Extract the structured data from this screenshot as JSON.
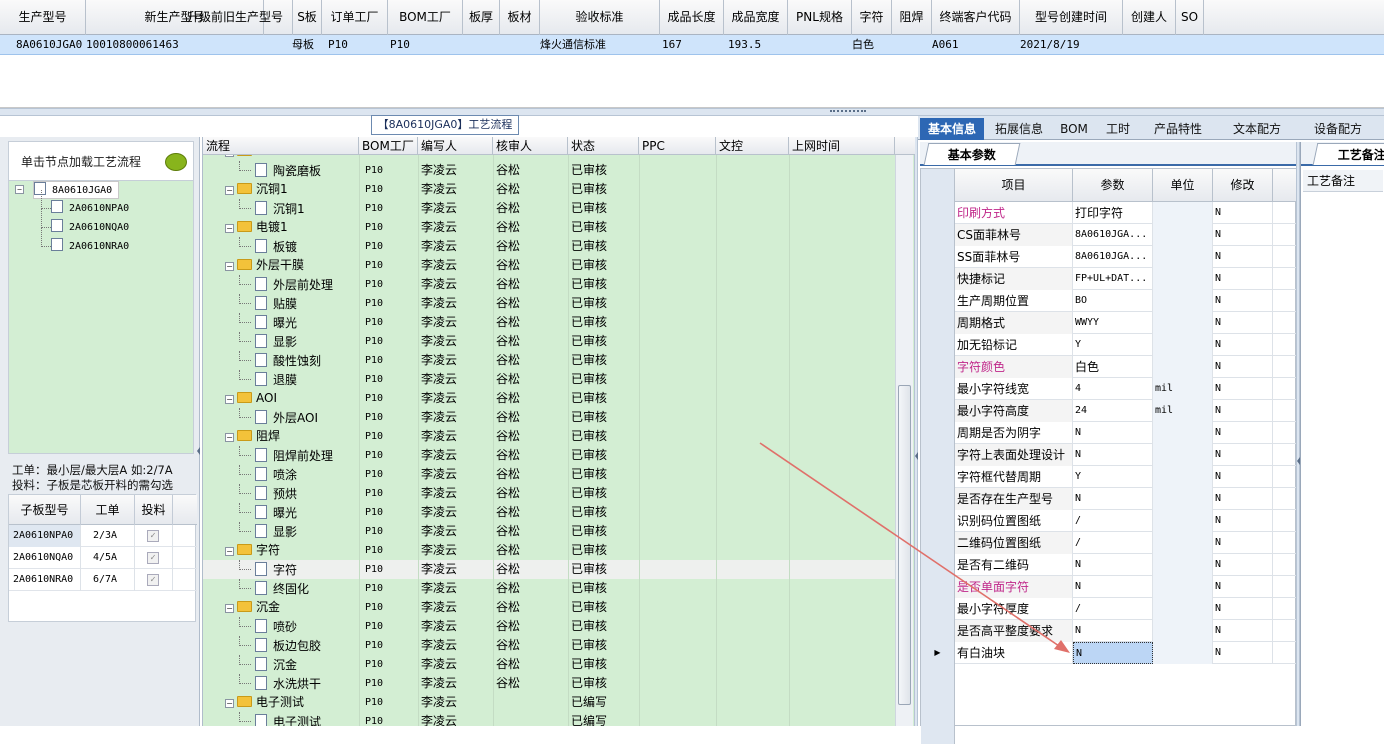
{
  "top_grid": {
    "headers": [
      "生产型号",
      "新生产型号",
      "升级前旧生产型号",
      "S板",
      "订单工厂",
      "BOM工厂",
      "板厚",
      "板材",
      "验收标准",
      "成品长度",
      "成品宽度",
      "PNL规格",
      "字符",
      "阻焊",
      "终端客户代码",
      "型号创建时间",
      "创建人",
      "SO"
    ],
    "row": [
      "8A0610JGA0",
      "10010800061463",
      "",
      "母板",
      "P10",
      "P10",
      "",
      "",
      "烽火通信标准",
      "167",
      "193.5",
      "",
      "白色",
      "",
      "A061",
      "2021/8/19",
      "",
      ""
    ]
  },
  "flow_title": "【8A0610JGA0】工艺流程",
  "left": {
    "tree_header": "单击节点加载工艺流程",
    "tree": {
      "root": "8A0610JGA0",
      "children": [
        "2A0610NPA0",
        "2A0610NQA0",
        "2A0610NRA0"
      ]
    },
    "note_line1": "工单：最小层/最大层A 如:2/7A",
    "note_line2": "投料：子板是芯板开料的需勾选",
    "sub_grid": {
      "headers": [
        "子板型号",
        "工单",
        "投料"
      ],
      "rows": [
        {
          "model": "2A0610NPA0",
          "order": "2/3A",
          "check": "✓"
        },
        {
          "model": "2A0610NQA0",
          "order": "4/5A",
          "check": "✓"
        },
        {
          "model": "2A0610NRA0",
          "order": "6/7A",
          "check": "✓"
        }
      ]
    }
  },
  "flow_grid": {
    "headers": [
      "流程",
      "BOM工厂",
      "编写人",
      "核审人",
      "状态",
      "PPC",
      "文控",
      "上网时间"
    ],
    "rows": [
      {
        "type": "doc",
        "name": "陶瓷磨板",
        "bom": "P10",
        "writer": "李凌云",
        "reviewer": "谷松",
        "status": "已审核"
      },
      {
        "type": "folder",
        "name": "沉铜1",
        "bom": "P10",
        "writer": "李凌云",
        "reviewer": "谷松",
        "status": "已审核"
      },
      {
        "type": "doc",
        "name": "沉铜1",
        "bom": "P10",
        "writer": "李凌云",
        "reviewer": "谷松",
        "status": "已审核"
      },
      {
        "type": "folder",
        "name": "电镀1",
        "bom": "P10",
        "writer": "李凌云",
        "reviewer": "谷松",
        "status": "已审核"
      },
      {
        "type": "doc",
        "name": "板镀",
        "bom": "P10",
        "writer": "李凌云",
        "reviewer": "谷松",
        "status": "已审核"
      },
      {
        "type": "folder",
        "name": "外层干膜",
        "bom": "P10",
        "writer": "李凌云",
        "reviewer": "谷松",
        "status": "已审核"
      },
      {
        "type": "doc",
        "name": "外层前处理",
        "bom": "P10",
        "writer": "李凌云",
        "reviewer": "谷松",
        "status": "已审核"
      },
      {
        "type": "doc",
        "name": "贴膜",
        "bom": "P10",
        "writer": "李凌云",
        "reviewer": "谷松",
        "status": "已审核"
      },
      {
        "type": "doc",
        "name": "曝光",
        "bom": "P10",
        "writer": "李凌云",
        "reviewer": "谷松",
        "status": "已审核"
      },
      {
        "type": "doc",
        "name": "显影",
        "bom": "P10",
        "writer": "李凌云",
        "reviewer": "谷松",
        "status": "已审核"
      },
      {
        "type": "doc",
        "name": "酸性蚀刻",
        "bom": "P10",
        "writer": "李凌云",
        "reviewer": "谷松",
        "status": "已审核"
      },
      {
        "type": "doc",
        "name": "退膜",
        "bom": "P10",
        "writer": "李凌云",
        "reviewer": "谷松",
        "status": "已审核"
      },
      {
        "type": "folder",
        "name": "AOI",
        "bom": "P10",
        "writer": "李凌云",
        "reviewer": "谷松",
        "status": "已审核"
      },
      {
        "type": "doc",
        "name": "外层AOI",
        "bom": "P10",
        "writer": "李凌云",
        "reviewer": "谷松",
        "status": "已审核"
      },
      {
        "type": "folder",
        "name": "阻焊",
        "bom": "P10",
        "writer": "李凌云",
        "reviewer": "谷松",
        "status": "已审核"
      },
      {
        "type": "doc",
        "name": "阻焊前处理",
        "bom": "P10",
        "writer": "李凌云",
        "reviewer": "谷松",
        "status": "已审核"
      },
      {
        "type": "doc",
        "name": "喷涂",
        "bom": "P10",
        "writer": "李凌云",
        "reviewer": "谷松",
        "status": "已审核"
      },
      {
        "type": "doc",
        "name": "预烘",
        "bom": "P10",
        "writer": "李凌云",
        "reviewer": "谷松",
        "status": "已审核"
      },
      {
        "type": "doc",
        "name": "曝光",
        "bom": "P10",
        "writer": "李凌云",
        "reviewer": "谷松",
        "status": "已审核"
      },
      {
        "type": "doc",
        "name": "显影",
        "bom": "P10",
        "writer": "李凌云",
        "reviewer": "谷松",
        "status": "已审核"
      },
      {
        "type": "folder",
        "name": "字符",
        "bom": "P10",
        "writer": "李凌云",
        "reviewer": "谷松",
        "status": "已审核"
      },
      {
        "type": "doc",
        "name": "字符",
        "bom": "P10",
        "writer": "李凌云",
        "reviewer": "谷松",
        "status": "已审核",
        "selected": true
      },
      {
        "type": "doc",
        "name": "终固化",
        "bom": "P10",
        "writer": "李凌云",
        "reviewer": "谷松",
        "status": "已审核"
      },
      {
        "type": "folder",
        "name": "沉金",
        "bom": "P10",
        "writer": "李凌云",
        "reviewer": "谷松",
        "status": "已审核"
      },
      {
        "type": "doc",
        "name": "喷砂",
        "bom": "P10",
        "writer": "李凌云",
        "reviewer": "谷松",
        "status": "已审核"
      },
      {
        "type": "doc",
        "name": "板边包胶",
        "bom": "P10",
        "writer": "李凌云",
        "reviewer": "谷松",
        "status": "已审核"
      },
      {
        "type": "doc",
        "name": "沉金",
        "bom": "P10",
        "writer": "李凌云",
        "reviewer": "谷松",
        "status": "已审核"
      },
      {
        "type": "doc",
        "name": "水洗烘干",
        "bom": "P10",
        "writer": "李凌云",
        "reviewer": "谷松",
        "status": "已审核"
      },
      {
        "type": "folder",
        "name": "电子测试",
        "bom": "P10",
        "writer": "李凌云",
        "reviewer": "",
        "status": "已编写"
      },
      {
        "type": "doc",
        "name": "电子测试",
        "bom": "P10",
        "writer": "李凌云",
        "reviewer": "",
        "status": "已编写"
      }
    ]
  },
  "right": {
    "tabs": [
      "基本信息",
      "拓展信息",
      "BOM",
      "工时",
      "产品特性",
      "文本配方",
      "设备配方"
    ],
    "subtab": "基本参数",
    "param_headers": [
      "项目",
      "参数",
      "单位",
      "修改"
    ],
    "params": [
      {
        "item": "印刷方式",
        "value": "打印字符",
        "unit": "",
        "mod": "N",
        "magenta": true
      },
      {
        "item": "CS面菲林号",
        "value": "8A0610JGA...",
        "unit": "",
        "mod": "N"
      },
      {
        "item": "SS面菲林号",
        "value": "8A0610JGA...",
        "unit": "",
        "mod": "N"
      },
      {
        "item": "快捷标记",
        "value": "FP+UL+DAT...",
        "unit": "",
        "mod": "N"
      },
      {
        "item": "生产周期位置",
        "value": "BO",
        "unit": "",
        "mod": "N"
      },
      {
        "item": "周期格式",
        "value": "WWYY",
        "unit": "",
        "mod": "N"
      },
      {
        "item": "加无铅标记",
        "value": "Y",
        "unit": "",
        "mod": "N"
      },
      {
        "item": "字符颜色",
        "value": "白色",
        "unit": "",
        "mod": "N",
        "magenta": true
      },
      {
        "item": "最小字符线宽",
        "value": "4",
        "unit": "mil",
        "mod": "N"
      },
      {
        "item": "最小字符高度",
        "value": "24",
        "unit": "mil",
        "mod": "N"
      },
      {
        "item": "周期是否为阴字",
        "value": "N",
        "unit": "",
        "mod": "N"
      },
      {
        "item": "字符上表面处理设计",
        "value": "N",
        "unit": "",
        "mod": "N"
      },
      {
        "item": "字符框代替周期",
        "value": "Y",
        "unit": "",
        "mod": "N"
      },
      {
        "item": "是否存在生产型号",
        "value": "N",
        "unit": "",
        "mod": "N"
      },
      {
        "item": "识别码位置图纸",
        "value": "/",
        "unit": "",
        "mod": "N"
      },
      {
        "item": "二维码位置图纸",
        "value": "/",
        "unit": "",
        "mod": "N"
      },
      {
        "item": "是否有二维码",
        "value": "N",
        "unit": "",
        "mod": "N"
      },
      {
        "item": "是否单面字符",
        "value": "N",
        "unit": "",
        "mod": "N",
        "magenta": true
      },
      {
        "item": "最小字符厚度",
        "value": "/",
        "unit": "",
        "mod": "N"
      },
      {
        "item": "是否高平整度要求",
        "value": "N",
        "unit": "",
        "mod": "N"
      },
      {
        "item": "有白油块",
        "value": "N",
        "unit": "",
        "mod": "N",
        "current": true
      }
    ]
  },
  "remark": {
    "tab": "工艺备注",
    "header": "工艺备注"
  },
  "colors": {
    "accent": "#2d67b4",
    "tree_bg": "#d3eed3",
    "selected_row": "#cfe4fb",
    "magenta": "#c0278a",
    "annotation_arrow": "#e0706a"
  }
}
